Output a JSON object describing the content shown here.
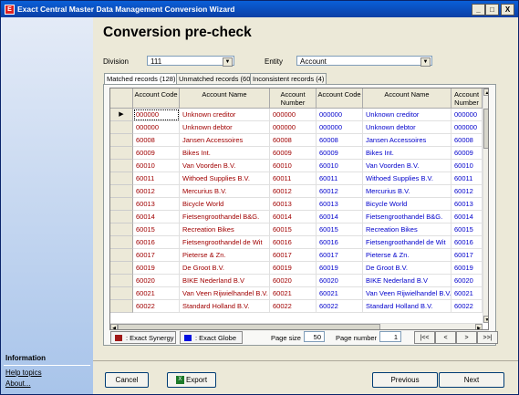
{
  "window": {
    "title": "Exact Central Master Data Management Conversion Wizard",
    "icon": "app-icon",
    "controls": [
      "_",
      "□",
      "X"
    ]
  },
  "sidebar": {
    "section_title": "Information",
    "links": [
      "Help topics",
      "About..."
    ]
  },
  "main": {
    "heading": "Conversion pre-check",
    "division_label": "Division",
    "division_value": "111",
    "entity_label": "Entity",
    "entity_value": "Account",
    "tabs": [
      "Matched records (128)",
      "Unmatched records (60)",
      "Inconsistent records (4)"
    ],
    "active_tab": 0
  },
  "grid": {
    "columns": [
      "Account Code",
      "Account Name",
      "Account Number",
      "Account Code",
      "Account Name",
      "Account Number"
    ],
    "synergy_color": "#a00000",
    "globe_color": "#0000cc",
    "rows": [
      [
        "000000",
        "Unknown creditor",
        "000000",
        "000000",
        "Unknown creditor",
        "000000"
      ],
      [
        "000000",
        "Unknown debtor",
        "000000",
        "000000",
        "Unknown debtor",
        "000000"
      ],
      [
        "60008",
        "Jansen Accessoires",
        "60008",
        "60008",
        "Jansen Accessoires",
        "60008"
      ],
      [
        "60009",
        "Bikes Int.",
        "60009",
        "60009",
        "Bikes Int.",
        "60009"
      ],
      [
        "60010",
        "Van Voorden B.V.",
        "60010",
        "60010",
        "Van Voorden B.V.",
        "60010"
      ],
      [
        "60011",
        "Withoed Supplies B.V.",
        "60011",
        "60011",
        "Withoed Supplies B.V.",
        "60011"
      ],
      [
        "60012",
        "Mercurius B.V.",
        "60012",
        "60012",
        "Mercurius B.V.",
        "60012"
      ],
      [
        "60013",
        "Bicycle World",
        "60013",
        "60013",
        "Bicycle World",
        "60013"
      ],
      [
        "60014",
        "Fietsengroothandel B&G.",
        "60014",
        "60014",
        "Fietsengroothandel B&G.",
        "60014"
      ],
      [
        "60015",
        "Recreation Bikes",
        "60015",
        "60015",
        "Recreation Bikes",
        "60015"
      ],
      [
        "60016",
        "Fietsengroothandel de Wit",
        "60016",
        "60016",
        "Fietsengroothandel de Wit",
        "60016"
      ],
      [
        "60017",
        "Pieterse & Zn.",
        "60017",
        "60017",
        "Pieterse & Zn.",
        "60017"
      ],
      [
        "60019",
        "De Groot B.V.",
        "60019",
        "60019",
        "De Groot B.V.",
        "60019"
      ],
      [
        "60020",
        "BIKE Nederland B.V",
        "60020",
        "60020",
        "BIKE Nederland B.V",
        "60020"
      ],
      [
        "60021",
        "Van Veen Rijwielhandel B.V.",
        "60021",
        "60021",
        "Van Veen Rijwielhandel B.V.",
        "60021"
      ],
      [
        "60022",
        "Standard Holland B.V.",
        "60022",
        "60022",
        "Standard Holland B.V.",
        "60022"
      ]
    ]
  },
  "footer": {
    "legend_synergy": ": Exact Synergy",
    "legend_globe": ": Exact Globe",
    "page_size_label": "Page size",
    "page_size_value": "50",
    "page_number_label": "Page number",
    "page_number_value": "1",
    "nav_first": "|<<",
    "nav_prev": "<",
    "nav_next": ">",
    "nav_last": ">>|"
  },
  "buttons": {
    "cancel": "Cancel",
    "export": "Export",
    "previous": "Previous",
    "next": "Next"
  }
}
